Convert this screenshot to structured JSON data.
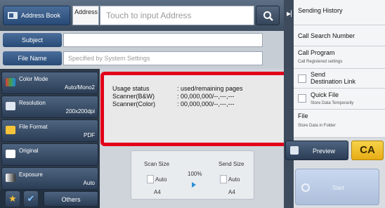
{
  "header": {
    "address_book_label": "Address Book",
    "address_label": "Address",
    "address_placeholder": "Touch to input Address"
  },
  "fields": {
    "subject_label": "Subject",
    "subject_value": "",
    "filename_label": "File Name",
    "filename_placeholder": "Specified by System Settings"
  },
  "settings": [
    {
      "name": "Color Mode",
      "value": "Auto/Mono2"
    },
    {
      "name": "Resolution",
      "value": "200x200dpi"
    },
    {
      "name": "File Format",
      "value": "PDF"
    },
    {
      "name": "Original",
      "value": ""
    },
    {
      "name": "Exposure",
      "value": "Auto"
    }
  ],
  "bottom": {
    "others_label": "Others"
  },
  "size_panel": {
    "scan_size_label": "Scan Size",
    "scan_size_value": "Auto",
    "scan_paper": "A4",
    "ratio": "100%",
    "send_size_label": "Send Size",
    "send_size_value": "Auto",
    "send_paper": "A4"
  },
  "popup": {
    "rows": [
      {
        "key": "Usage status",
        "value": ": used/remaining pages"
      },
      {
        "key": "Scanner(B&W)",
        "value": ": 00,000,000/--,---,---"
      },
      {
        "key": "Scanner(Color)",
        "value": ": 00,000,000/--,---,---"
      }
    ]
  },
  "right_panel": {
    "sending_history": "Sending History",
    "call_search_number": "Call Search Number",
    "call_program": "Call Program",
    "call_program_sub": "Call Registered settings",
    "send_destination_link": "Send\nDestination Link",
    "quick_file": "Quick File",
    "quick_file_sub": "Store Data Temporarily",
    "file": "File",
    "file_sub": "Store Data in Folder"
  },
  "actions": {
    "preview_label": "Preview",
    "ca_label": "CA",
    "start_label": "Start"
  },
  "colors": {
    "highlight_border": "#e2001a",
    "ca_yellow": "#f3c632",
    "nav_blue": "#274a76"
  }
}
